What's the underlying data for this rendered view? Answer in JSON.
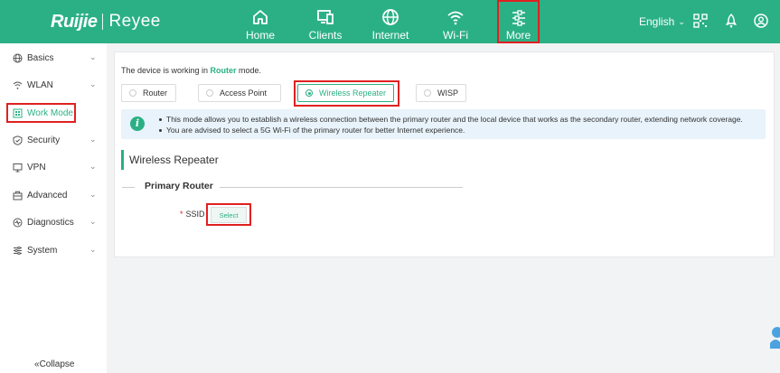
{
  "brand": {
    "left": "Ruijie",
    "right": "Reyee"
  },
  "topnav": {
    "items": [
      {
        "label": "Home",
        "icon": "home-icon"
      },
      {
        "label": "Clients",
        "icon": "monitor-icon"
      },
      {
        "label": "Internet",
        "icon": "globe-icon"
      },
      {
        "label": "Wi-Fi",
        "icon": "wifi-icon"
      },
      {
        "label": "More",
        "icon": "sliders-icon"
      }
    ],
    "language": "English"
  },
  "sidebar": {
    "items": [
      {
        "label": "Basics",
        "icon": "globe-icon"
      },
      {
        "label": "WLAN",
        "icon": "wifi-icon"
      },
      {
        "label": "Work Mode",
        "icon": "grid-icon"
      },
      {
        "label": "Security",
        "icon": "shield-icon"
      },
      {
        "label": "VPN",
        "icon": "monitor-icon"
      },
      {
        "label": "Advanced",
        "icon": "toolbox-icon"
      },
      {
        "label": "Diagnostics",
        "icon": "diagnostics-icon"
      },
      {
        "label": "System",
        "icon": "sliders-icon"
      }
    ],
    "collapse": "Collapse"
  },
  "main": {
    "mode_prefix": "The device is working in ",
    "mode_value": "Router",
    "mode_suffix": " mode.",
    "modes": [
      {
        "label": "Router",
        "selected": false
      },
      {
        "label": "Access Point",
        "selected": false
      },
      {
        "label": "Wireless Repeater",
        "selected": true
      },
      {
        "label": "WISP",
        "selected": false
      }
    ],
    "info_lines": [
      "This mode allows you to establish a wireless connection between the primary router and the local device that works as the secondary router, extending network coverage.",
      "You are advised to select a 5G Wi-Fi of the primary router for better Internet experience."
    ],
    "section_title": "Wireless Repeater",
    "subsection_title": "Primary Router",
    "ssid_required": "*",
    "ssid_label": "SSID",
    "select_label": "Select"
  },
  "colors": {
    "brand": "#2bb085",
    "highlight_box": "#e02020",
    "info_bg": "#e8f3fb"
  }
}
